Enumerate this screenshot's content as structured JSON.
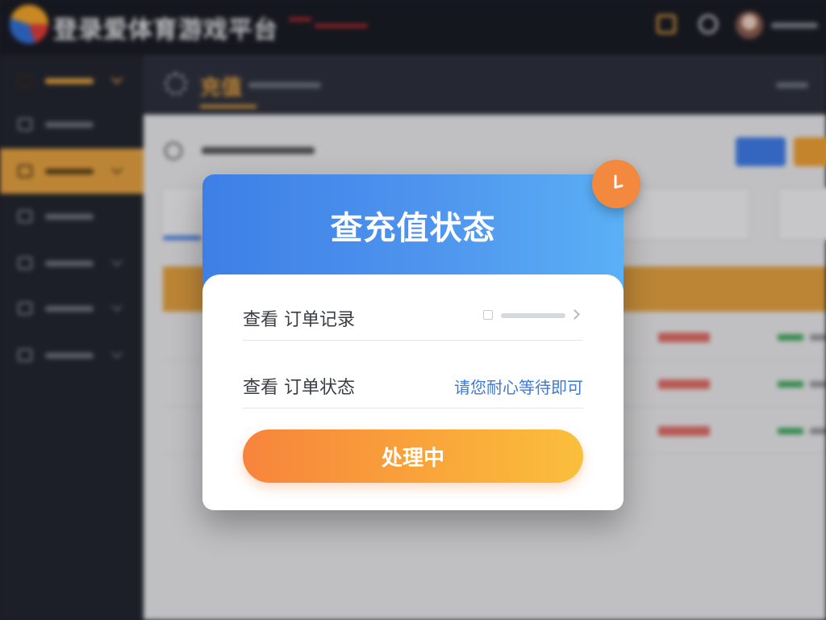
{
  "background": {
    "app_title": "登录爱体育游戏平台",
    "page_title": "充值"
  },
  "modal": {
    "title": "查充值状态",
    "rows": [
      {
        "label": "查看 订单记录",
        "status": ""
      },
      {
        "label": "查看 订单状态",
        "status": "请您耐心等待即可"
      }
    ],
    "button_label": "处理中"
  },
  "colors": {
    "accent": "#e6a23c",
    "modal_header": "#4f95ee",
    "button": "#f9a53a",
    "badge": "#f3883f",
    "status_link": "#3c78d8"
  },
  "icons": [
    "logo-icon",
    "notification-icon",
    "message-icon",
    "avatar",
    "settings-icon",
    "clock-icon",
    "chevron-right-icon"
  ]
}
